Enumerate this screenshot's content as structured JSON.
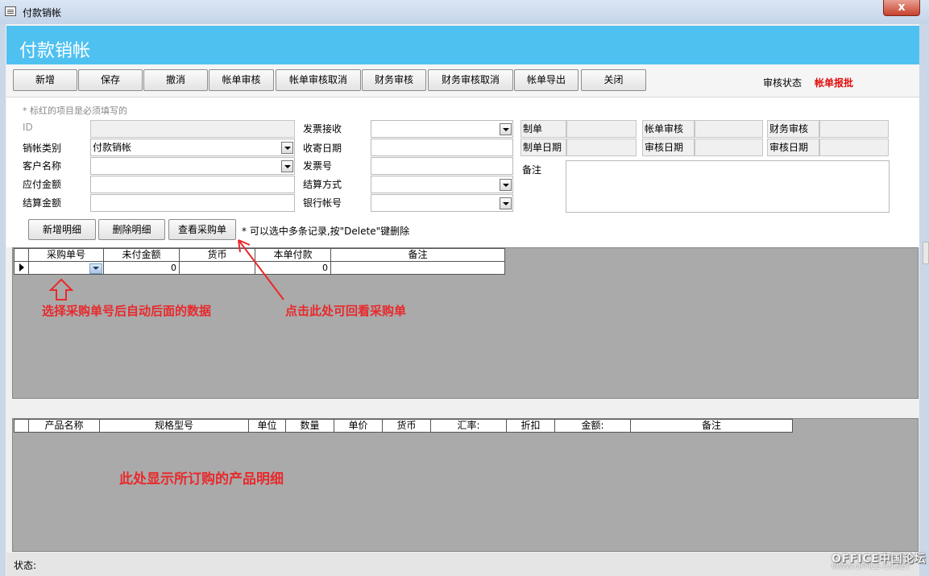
{
  "window": {
    "title": "付款销帐",
    "close_symbol": "x"
  },
  "header": {
    "title": "付款销帐"
  },
  "toolbar": {
    "buttons": [
      "新增",
      "保存",
      "撤消",
      "帐单审核",
      "帐单审核取消",
      "财务审核",
      "财务审核取消",
      "帐单导出",
      "关闭"
    ],
    "status_label": "审核状态",
    "status_value": "帐单报批",
    "status_color": "#e01010"
  },
  "form": {
    "required_hint": "* 标红的项目是必须填写的",
    "id_label": "ID",
    "type_label": "销帐类别",
    "type_value": "付款销帐",
    "customer_label": "客户名称",
    "payable_label": "应付金额",
    "settle_amount_label": "结算金额",
    "invoice_received_label": "发票接收",
    "receive_date_label": "收寄日期",
    "invoice_no_label": "发票号",
    "settle_method_label": "结算方式",
    "bank_account_label": "银行帐号",
    "maker_label": "制单",
    "make_date_label": "制单日期",
    "bill_audit_label": "帐单审核",
    "audit_date_label": "审核日期",
    "finance_audit_label": "财务审核",
    "finance_audit_date_label": "审核日期",
    "remark_label": "备注"
  },
  "detail_buttons": {
    "add": "新增明细",
    "delete": "删除明细",
    "view_po": "查看采购单",
    "delete_hint": "* 可以选中多条记录,按\"Delete\"键删除"
  },
  "grid1": {
    "headers": [
      "采购单号",
      "未付金额",
      "货币",
      "本单付款",
      "备注"
    ],
    "row": {
      "unpaid": "0",
      "this_payment": "0"
    }
  },
  "grid2": {
    "headers": [
      "产品名称",
      "规格型号",
      "单位",
      "数量",
      "单价",
      "货币",
      "汇率:",
      "折扣",
      "金额:",
      "备注"
    ]
  },
  "annotations": {
    "select_po": "选择采购单号后自动后面的数据",
    "click_here": "点击此处可回看采购单",
    "product_detail": "此处显示所订购的产品明细",
    "color": "#e8292c"
  },
  "statusbar": {
    "label": "状态:"
  },
  "watermark": {
    "main": "OFFICE中国论坛",
    "sub": "WWW.OFFICE-CN.NET"
  }
}
